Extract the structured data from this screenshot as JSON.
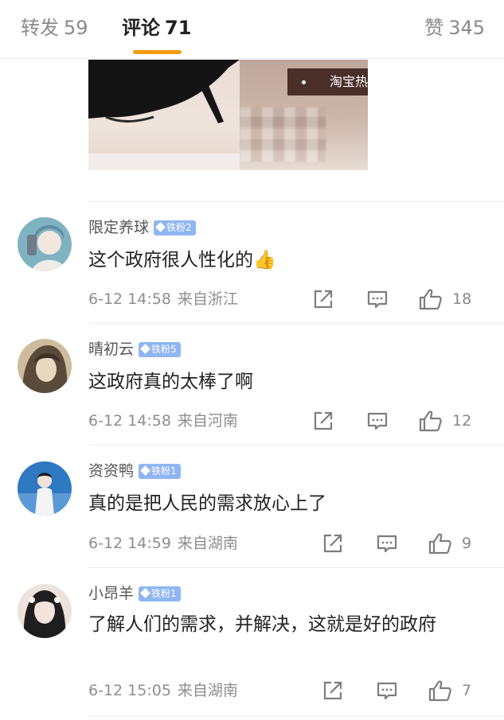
{
  "tabs": {
    "repost": {
      "label": "转发",
      "count": "59"
    },
    "comments": {
      "label": "评论",
      "count": "71"
    },
    "likes": {
      "label": "赞",
      "count": "345"
    }
  },
  "media": {
    "label": "淘宝热"
  },
  "colors": {
    "accent": "#f39c12",
    "badge": "#8fb6f2"
  },
  "comments": [
    {
      "user": "限定养球",
      "badge": "铁粉2",
      "text": "这个政府很人性化的👍",
      "date": "6-12 14:58",
      "location": "来自浙江",
      "likes": "18",
      "avatar_colors": [
        "#6ca8b8",
        "#e9e2d8"
      ]
    },
    {
      "user": "晴初云",
      "badge": "铁粉5",
      "text": "这政府真的太棒了啊",
      "date": "6-12 14:58",
      "location": "来自河南",
      "likes": "12",
      "avatar_colors": [
        "#7a6a57",
        "#d9c9b0"
      ]
    },
    {
      "user": "资资鸭",
      "badge": "铁粉1",
      "text": "真的是把人民的需求放心上了",
      "date": "6-12 14:59",
      "location": "来自湖南",
      "likes": "9",
      "avatar_colors": [
        "#3a7fc4",
        "#e8f0f7"
      ]
    },
    {
      "user": "小昂羊",
      "badge": "铁粉1",
      "text": "了解人们的需求，并解决，这就是好的政府",
      "date": "6-12 15:05",
      "location": "来自湖南",
      "likes": "7",
      "avatar_colors": [
        "#2a2a2a",
        "#e6d6cf"
      ]
    }
  ],
  "icons": {
    "repost": "share-icon",
    "comment": "comment-icon",
    "like": "thumbs-up-icon",
    "badge": "diamond-icon"
  }
}
